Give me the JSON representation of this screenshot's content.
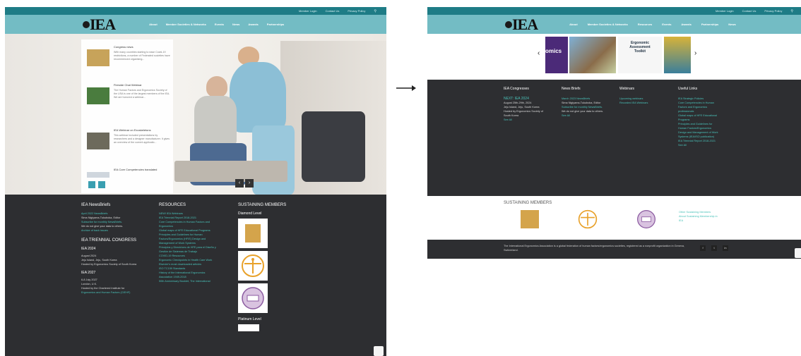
{
  "common": {
    "utility_nav": [
      "Member Login",
      "Contact Us",
      "Privacy Policy"
    ],
    "logo_text": "IEA"
  },
  "left": {
    "menu": [
      "About",
      "Member Societies & Networks",
      "Events",
      "News",
      "Awards",
      "Partnerships"
    ],
    "news_panel": [
      {
        "title": "Congress news",
        "text": "With many countries starting to ease Covid-19 restrictions, a number of Federated societies have recommenced organising..."
      },
      {
        "title": "Fireside Chat Webinar",
        "text": "The Human Factors and Ergonomics Society of the USA is one of the largest members of the IEA. We are honored a webinar..."
      },
      {
        "title": "IEA Webinar on Exoskeletons",
        "text": "This webinar included presentations by researchers and a designer manufacturer. It gives an overview of the current applicatio..."
      },
      {
        "title": "IEA Core Competencies translated",
        "text": ""
      }
    ],
    "newsbriefs": {
      "heading": "IEA NewsBriefs",
      "lines": [
        "April 2022 NewsBriefs",
        "Sima Nigiyama-Tukuboka, Editor",
        "Subscribe for monthly NewsBriefs.",
        "We do not give your data to others.",
        "Archive of back issues"
      ]
    },
    "triennial": {
      "heading": "IEA TRIENNIAL CONGRESS",
      "y2024": "IEA 2024",
      "lines2024": [
        "August 2024",
        "Jeju Island, Jeju, South Korea",
        "Hosted by Ergonomics Society of South Korea"
      ],
      "y2027": "IEA 2027",
      "lines2027": [
        "6-8 July 2027",
        "London, U.K.",
        "Hosted by the Chartered Institute for",
        "Ergonomics and Human Factors (CIEHF)"
      ]
    },
    "resources": {
      "heading": "RESOURCES",
      "lines": [
        "NEW! IEA Webinars",
        "IEA Triennial Report 2018-2021",
        "Core Competencies in Human Factors and",
        "Ergonomics",
        "Global maps of HFE Educational Programs",
        "Principles and Guidelines for Human",
        "Factors/Ergonomics (HF/E) Design and",
        "Management of Work Systems",
        "Principios y Directrices de HFE para el Diseño y",
        "Gestión de Sistemas de Trabajo",
        "COVID-19 Resources",
        "Ergonomic Checkpoints in Health Care Work",
        "Elsevier's most downloaded articles",
        "ISO TC159 Standards",
        "History of the International Ergonomics",
        "Association 1949-2018",
        "50th Anniversary Booklet, The International"
      ]
    },
    "sustaining": {
      "heading": "SUSTAINING MEMBERS",
      "diamond": "Diamond Level",
      "platinum": "Platinum Level"
    }
  },
  "right": {
    "menu": [
      "About",
      "Member Societies & Networks",
      "Resources",
      "Events",
      "Awards",
      "Partnerships",
      "News"
    ],
    "carousel_caption": [
      "Ergonomic",
      "Assessment",
      "Toolkit"
    ],
    "carousel_partial": "omics",
    "congresses": {
      "heading": "IEA Congresses",
      "next": "NEXT: IEA 2024",
      "lines": [
        "August 25th-29th, 2024",
        "Jeju Island, Jeju, South Korea",
        "Hosted by Ergonomics Society of",
        "South Korea",
        "See All"
      ]
    },
    "newsbriefs": {
      "heading": "News Briefs",
      "lines": [
        "March 2023 NewsBriefs",
        "Sima Nigiyama-Tukuboka, Editor",
        "Subscribe for monthly NewsBriefs.",
        "We do not give your data to others.",
        "See All"
      ]
    },
    "webinars": {
      "heading": "Webinars",
      "lines": [
        "Upcoming webinars",
        "Recorded IEA Webinars"
      ]
    },
    "useful": {
      "heading": "Useful Links",
      "lines": [
        "IEA Strategic Policies",
        "Core Competencies in Human",
        "Factors and Ergonomics",
        "professionals",
        "Global maps of HFE Educational",
        "Programs",
        "Principles and Guidelines for",
        "Human Factors/Ergonomics",
        "Design and Management of Work",
        "Systems (IEA/ISO publication)",
        "IEA Triennial Report 2018-2021",
        "See All"
      ]
    },
    "sustaining_heading": "SUSTAINING MEMBERS",
    "sustaining_links": [
      "Other Sustaining Members",
      "About Sustaining Membership in",
      "IEA"
    ],
    "copyright": "The International Ergonomics Association is a global federation of human factors/ergonomics societies, registered as a nonprofit organization in Geneva, Switzerland.",
    "social": [
      "f",
      "t",
      "in"
    ]
  },
  "colors": {
    "teal_dark": "#1e7c86",
    "teal": "#73bcc4",
    "footer": "#2d2e31",
    "link": "#49c2b9"
  }
}
